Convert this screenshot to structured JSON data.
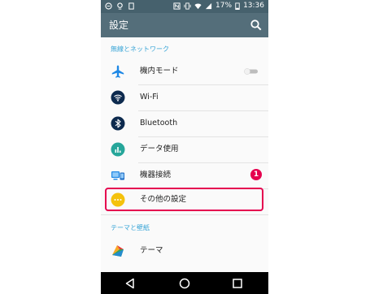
{
  "status_bar": {
    "battery": "17%",
    "time": "13:36",
    "icons": [
      "message-icon",
      "location-icon",
      "sim-icon",
      "nfc-icon",
      "vibrate-icon",
      "wifi-icon",
      "signal-icon",
      "battery-icon"
    ]
  },
  "app_bar": {
    "title": "設定"
  },
  "sections": [
    {
      "header": "無線とネットワーク",
      "items": [
        {
          "label": "機内モード",
          "icon": "airplane-icon",
          "icon_color": "#1e88e5",
          "has_toggle": true
        },
        {
          "label": "Wi-Fi",
          "icon": "wifi-icon",
          "icon_color": "#0d2a4e"
        },
        {
          "label": "Bluetooth",
          "icon": "bluetooth-icon",
          "icon_color": "#0d2a4e"
        },
        {
          "label": "データ使用",
          "icon": "data-usage-icon",
          "icon_color": "#26a69a"
        },
        {
          "label": "機器接続",
          "icon": "device-connection-icon",
          "icon_color": "#1e88e5"
        },
        {
          "label": "その他の設定",
          "icon": "more-icon",
          "icon_color": "#f4c20d"
        }
      ]
    },
    {
      "header": "テーマと壁紙",
      "items": [
        {
          "label": "テーマ",
          "icon": "theme-icon"
        }
      ]
    }
  ],
  "callout": {
    "number": "1",
    "color": "#e5004f"
  },
  "colors": {
    "status_bar": "#46616d",
    "app_bar": "#546e7a",
    "section_header": "#37a4d6"
  }
}
